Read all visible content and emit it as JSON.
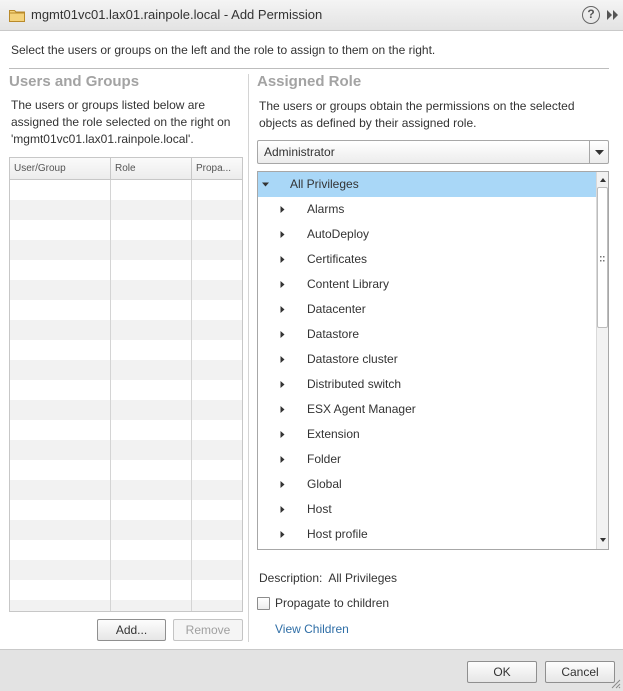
{
  "dialog": {
    "title": "mgmt01vc01.lax01.rainpole.local - Add Permission",
    "help_glyph": "?",
    "instruction": "Select the users or groups on the left and the role to assign to them on the right."
  },
  "users_groups": {
    "heading": "Users and Groups",
    "description_lines": [
      "The users or groups listed below are",
      "assigned the role selected on the right on",
      "'mgmt01vc01.lax01.rainpole.local'."
    ],
    "columns": [
      "User/Group",
      "Role",
      "Propa..."
    ],
    "add_label": "Add...",
    "remove_label": "Remove"
  },
  "assigned_role": {
    "heading": "Assigned Role",
    "description_lines": [
      "The users or groups obtain the permissions on the selected",
      "objects as defined by their assigned role."
    ],
    "selected_role": "Administrator",
    "privileges_root": "All Privileges",
    "privileges": [
      "Alarms",
      "AutoDeploy",
      "Certificates",
      "Content Library",
      "Datacenter",
      "Datastore",
      "Datastore cluster",
      "Distributed switch",
      "ESX Agent Manager",
      "Extension",
      "Folder",
      "Global",
      "Host",
      "Host profile"
    ],
    "description_label": "Description:",
    "description_value": "All Privileges",
    "propagate_label": "Propagate to children",
    "propagate_checked": false,
    "view_children_label": "View Children"
  },
  "footer": {
    "ok_label": "OK",
    "cancel_label": "Cancel"
  },
  "colors": {
    "selection": "#a9d7f7",
    "link": "#2f6ea6",
    "heading_gray": "#a3a3a3"
  },
  "icons": {
    "title": "folder-icon",
    "help": "help-icon",
    "expand": "double-chevron-right-icon",
    "tree_expanded": "triangle-down-icon",
    "tree_collapsed": "triangle-right-icon"
  }
}
